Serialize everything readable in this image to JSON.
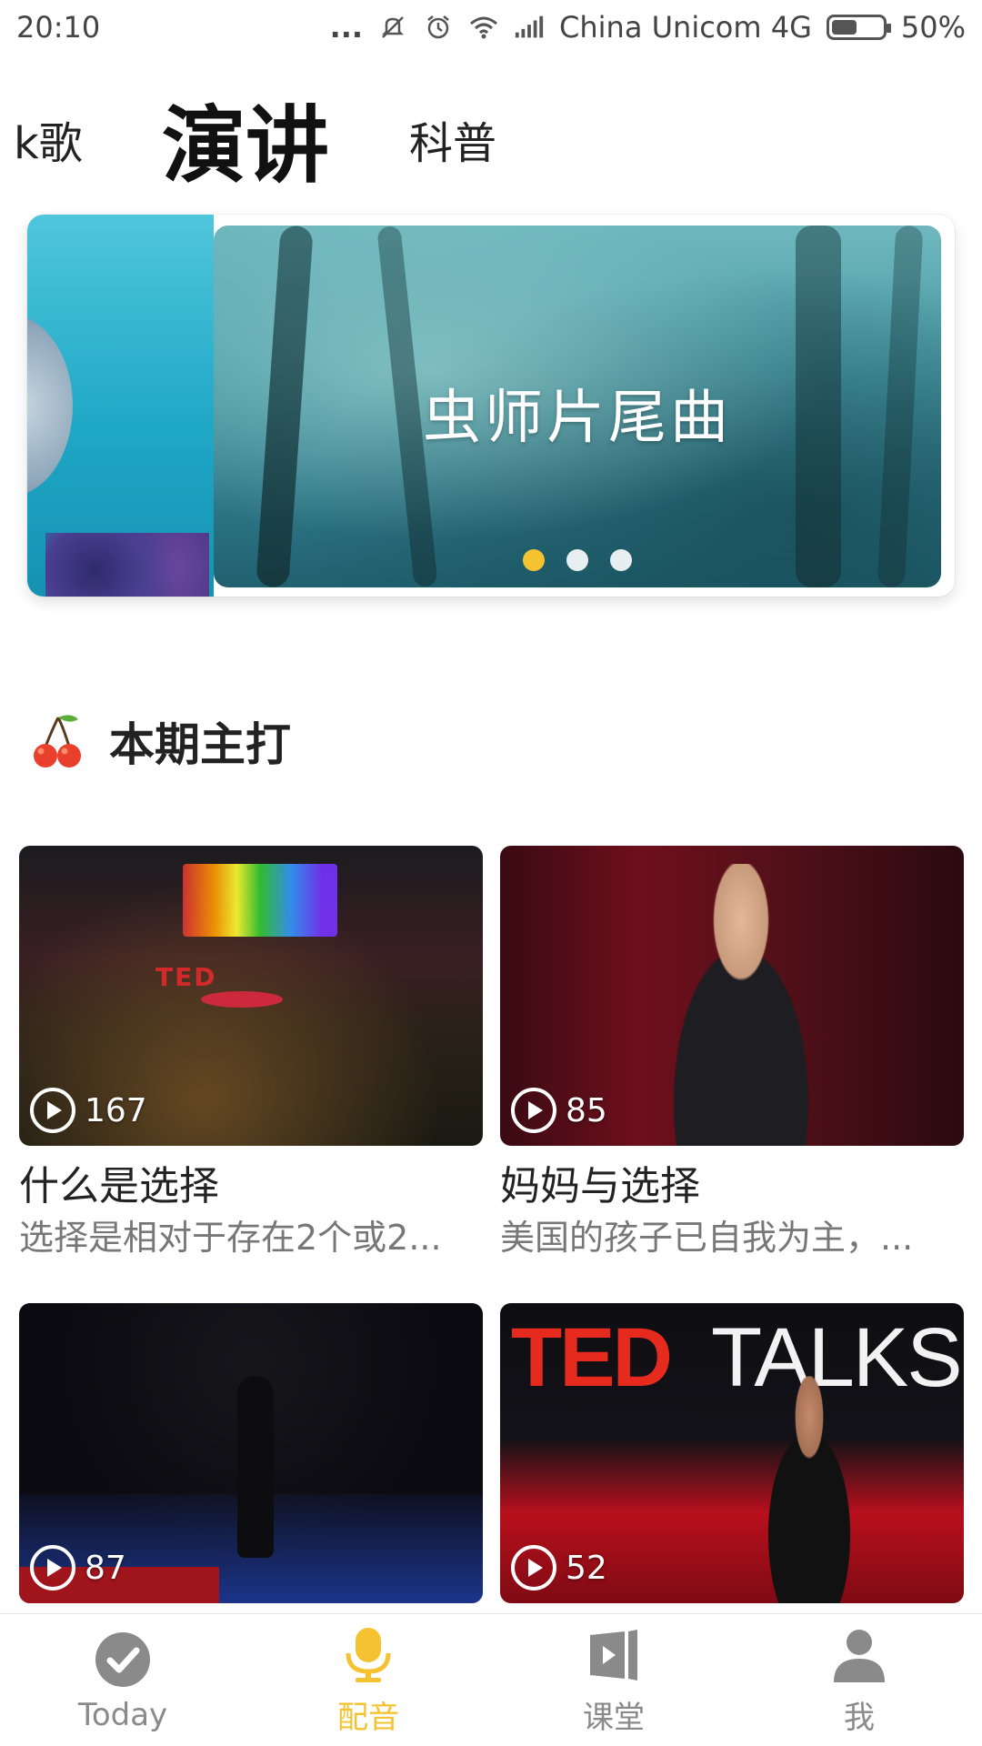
{
  "status_bar": {
    "time": "20:10",
    "dots": "...",
    "carrier": "China Unicom 4G",
    "battery_text": "50%",
    "battery_level": 0.5
  },
  "tabs": {
    "left": "k歌",
    "active": "演讲",
    "right": "科普"
  },
  "banner": {
    "title": "虫师片尾曲",
    "slide_count": 3,
    "active_index": 0
  },
  "section": {
    "title": "本期主打",
    "icon": "cherry-icon"
  },
  "cards": [
    {
      "title": "什么是选择",
      "desc": "选择是相对于存在2个或2...",
      "plays": "167"
    },
    {
      "title": "妈妈与选择",
      "desc": "美国的孩子已自我为主，...",
      "plays": "85"
    },
    {
      "title": "",
      "desc": "",
      "plays": "87"
    },
    {
      "title": "",
      "desc": "",
      "plays": "52",
      "thumb_text_left": "TED",
      "thumb_text_right": "TALKS"
    }
  ],
  "bottom_nav": {
    "items": [
      {
        "label": "Today",
        "icon": "check-circle-icon",
        "active": false
      },
      {
        "label": "配音",
        "icon": "microphone-icon",
        "active": true
      },
      {
        "label": "课堂",
        "icon": "video-book-icon",
        "active": false
      },
      {
        "label": "我",
        "icon": "person-icon",
        "active": false
      }
    ]
  },
  "colors": {
    "accent": "#f5c332",
    "inactive": "#8a8a8a",
    "text": "#222222"
  }
}
